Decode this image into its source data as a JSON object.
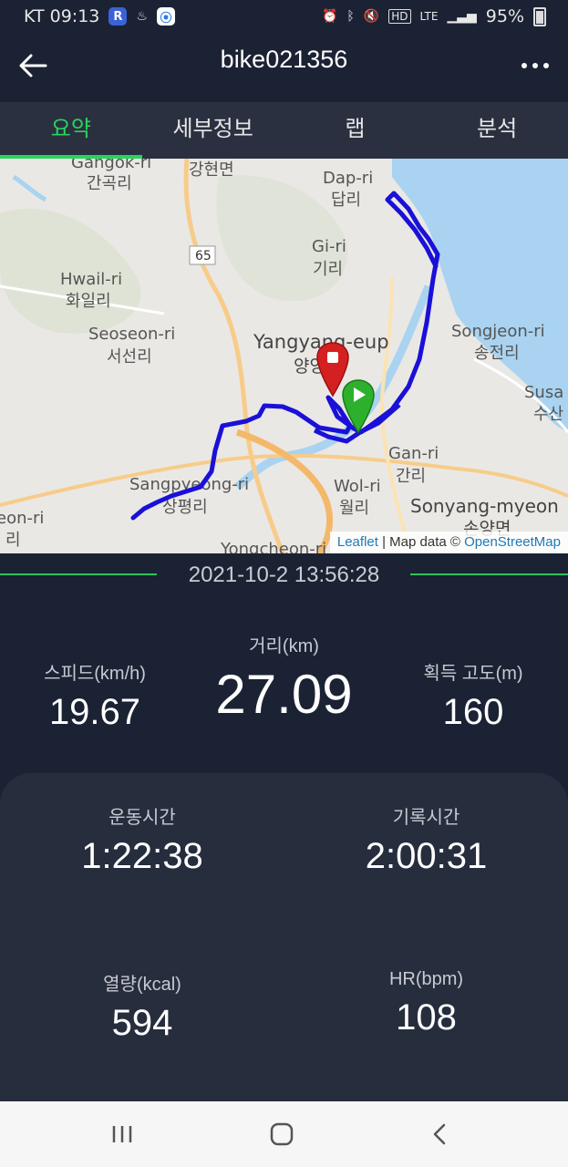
{
  "status": {
    "carrier_time": "KT 09:13",
    "signal_mode": "HD",
    "network": "LTE",
    "battery": "95%"
  },
  "header": {
    "title": "bike021356"
  },
  "tabs": [
    {
      "label": "요약",
      "active": true
    },
    {
      "label": "세부정보",
      "active": false
    },
    {
      "label": "랩",
      "active": false
    },
    {
      "label": "분석",
      "active": false
    }
  ],
  "map": {
    "labels": {
      "gangok": "Gangok-ri",
      "gangok_ko": "간곡리",
      "ganghyeon": "강현면",
      "dap": "Dap-ri",
      "dap_ko": "답리",
      "road": "65",
      "gi": "Gi-ri",
      "gi_ko": "기리",
      "hwail": "Hwail-ri",
      "hwail_ko": "화일리",
      "seoseon": "Seoseon-ri",
      "seoseon_ko": "서선리",
      "yangyang": "Yangyang-eup",
      "yangyang_ko": "양양읍",
      "songjeon": "Songjeon-ri",
      "songjeon_ko": "송전리",
      "susan": "Susa",
      "susan_ko": "수산",
      "gan": "Gan-ri",
      "gan_ko": "간리",
      "wol": "Wol-ri",
      "wol_ko": "월리",
      "sangpyeong": "Sangpyeong-ri",
      "sangpyeong_ko": "상평리",
      "sonyang": "Sonyang-myeon",
      "sonyang_ko": "손양면",
      "eon": "eon-ri",
      "eon_ko": "리",
      "yongcheon": "Yongcheon-ri"
    },
    "attribution": {
      "leaflet": "Leaflet",
      "sep": "| Map data ©",
      "osm": "OpenStreetMap"
    },
    "colors": {
      "route": "#1a10d8",
      "start_pin": "#2db12d",
      "end_pin": "#d42020",
      "sea": "#a9d3f0"
    }
  },
  "summary": {
    "datetime": "2021-10-2 13:56:28",
    "speed": {
      "label": "스피드(km/h)",
      "value": "19.67"
    },
    "distance": {
      "label": "거리(km)",
      "value": "27.09"
    },
    "elevation": {
      "label": "획득 고도(m)",
      "value": "160"
    },
    "moving_time": {
      "label": "운동시간",
      "value": "1:22:38"
    },
    "elapsed_time": {
      "label": "기록시간",
      "value": "2:00:31"
    },
    "calories": {
      "label": "열량(kcal)",
      "value": "594"
    },
    "heart_rate": {
      "label": "HR(bpm)",
      "value": "108"
    }
  },
  "accent_color": "#27d45c"
}
